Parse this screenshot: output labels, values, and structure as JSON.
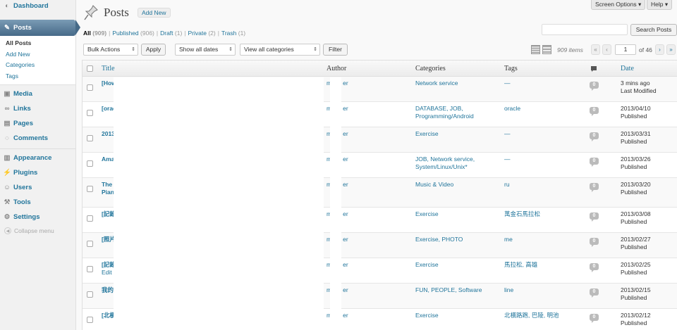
{
  "topbar": {
    "screen_options": "Screen Options ▾",
    "help": "Help ▾"
  },
  "sidebar": {
    "dashboard": "Dashboard",
    "posts": "Posts",
    "posts_sub": [
      "All Posts",
      "Add New",
      "Categories",
      "Tags"
    ],
    "items": [
      "Media",
      "Links",
      "Pages",
      "Comments"
    ],
    "items2": [
      "Appearance",
      "Plugins",
      "Users",
      "Tools",
      "Settings"
    ],
    "collapse": "Collapse menu"
  },
  "header": {
    "title": "Posts",
    "add_new": "Add New"
  },
  "status": {
    "all": "All",
    "all_count": "(909)",
    "published": "Published",
    "published_count": "(906)",
    "draft": "Draft",
    "draft_count": "(1)",
    "private": "Private",
    "private_count": "(2)",
    "trash": "Trash",
    "trash_count": "(1)"
  },
  "search": {
    "placeholder": "",
    "button": "Search Posts"
  },
  "nav": {
    "bulk_actions": "Bulk Actions",
    "apply": "Apply",
    "dates": "Show all dates",
    "categories": "View all categories",
    "filter": "Filter",
    "items": "909 items",
    "first": "«",
    "prev": "‹",
    "page": "1",
    "of": "of 46",
    "next": "›",
    "last": "»"
  },
  "table": {
    "columns": {
      "title": "Title",
      "author": "Author",
      "categories": "Categories",
      "tags": "Tags",
      "date": "Date"
    },
    "rows": [
      {
        "title": "[How",
        "title2": "",
        "author_a": "m",
        "author_b": "er",
        "categories": "Network service",
        "tags": "—",
        "comments": "0",
        "date": "3 mins ago",
        "status": "Last Modified",
        "h": 36
      },
      {
        "title": "[orac",
        "title2": "",
        "author_a": "m",
        "author_b": "er",
        "categories": "DATABASE, JOB, Programming/Android",
        "tags": "oracle",
        "comments": "0",
        "date": "2013/04/10",
        "status": "Published",
        "h": 36
      },
      {
        "title": "2013",
        "title2": "",
        "author_a": "m",
        "author_b": "er",
        "categories": "Exercise",
        "tags": "—",
        "comments": "0",
        "date": "2013/03/31",
        "status": "Published",
        "h": 36
      },
      {
        "title": "Ama",
        "title2": "",
        "author_a": "m",
        "author_b": "er",
        "categories": "JOB, Network service, System/Linux/Unix*",
        "tags": "—",
        "comments": "0",
        "date": "2013/03/26",
        "status": "Published",
        "h": 36
      },
      {
        "title": "The I",
        "title2": "Pian",
        "author_a": "m",
        "author_b": "er",
        "categories": "Music & Video",
        "tags": "ru",
        "comments": "0",
        "date": "2013/03/20",
        "status": "Published",
        "h": 42
      },
      {
        "title": "[記錄",
        "title2": "",
        "author_a": "m",
        "author_b": "er",
        "categories": "Exercise",
        "tags": "萬金石馬拉松",
        "comments": "0",
        "date": "2013/03/08",
        "status": "Published",
        "h": 36
      },
      {
        "title": "[照片",
        "title2": "",
        "author_a": "m",
        "author_b": "er",
        "categories": "Exercise, PHOTO",
        "tags": "me",
        "comments": "0",
        "date": "2013/02/27",
        "status": "Published",
        "h": 36
      },
      {
        "title": "[記錄",
        "title2": "Edit I",
        "author_a": "m",
        "author_b": "er",
        "categories": "Exercise",
        "tags": "馬拉松, 高雄",
        "comments": "0",
        "date": "2013/02/25",
        "status": "Published",
        "h": 36
      },
      {
        "title": "我的I",
        "title2": "",
        "author_a": "m",
        "author_b": "er",
        "categories": "FUN, PEOPLE, Software",
        "tags": "line",
        "comments": "0",
        "date": "2013/02/15",
        "status": "Published",
        "h": 36
      },
      {
        "title": "[北橫",
        "title2": "",
        "author_a": "m",
        "author_b": "er",
        "categories": "Exercise",
        "tags": "北橫路跑, 巴陵, 明池",
        "comments": "0",
        "date": "2013/02/12",
        "status": "Published",
        "h": 36
      }
    ]
  }
}
